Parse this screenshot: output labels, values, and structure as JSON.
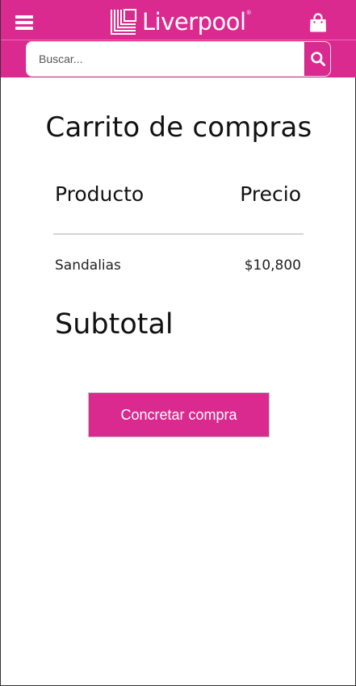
{
  "colors": {
    "brand": "#db2a8f",
    "text": "#111111",
    "background": "#ffffff"
  },
  "header": {
    "menu_icon": "hamburger-menu-icon",
    "logo_text": "Liverpool",
    "logo_registered": "®",
    "bag_icon": "shopping-bag-icon"
  },
  "search": {
    "placeholder": "Buscar...",
    "value": "",
    "button_icon": "search-icon"
  },
  "cart": {
    "title": "Carrito de compras",
    "columns": {
      "product": "Producto",
      "price": "Precio"
    },
    "items": [
      {
        "name": "Sandalias",
        "price": "$10,800"
      }
    ],
    "subtotal_label": "Subtotal",
    "checkout_label": "Concretar compra"
  }
}
